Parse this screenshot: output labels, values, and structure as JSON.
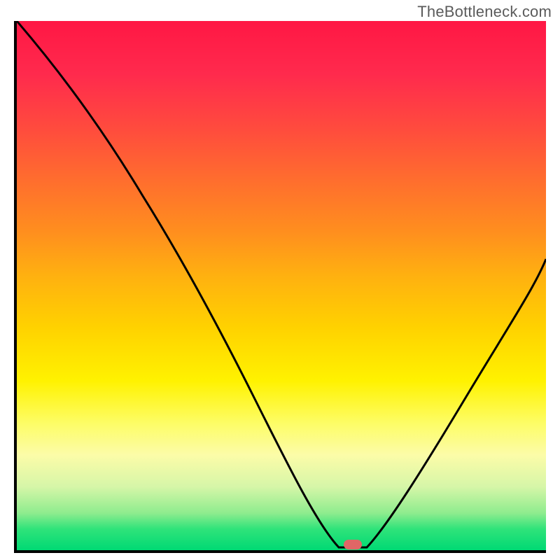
{
  "watermark": "TheBottleneck.com",
  "chart_data": {
    "type": "line",
    "title": "",
    "xlabel": "",
    "ylabel": "",
    "xlim": [
      0,
      100
    ],
    "ylim": [
      0,
      100
    ],
    "x": [
      0,
      10,
      20,
      30,
      40,
      50,
      58,
      62,
      66,
      70,
      80,
      90,
      100
    ],
    "values": [
      100,
      88,
      72,
      54,
      36,
      18,
      4,
      0,
      0,
      4,
      18,
      36,
      55
    ],
    "marker": {
      "x": 64,
      "y": 0,
      "color": "#e06666"
    },
    "background_gradient": {
      "top": "#ff1744",
      "mid": "#ffd200",
      "bottom": "#00d974"
    }
  }
}
